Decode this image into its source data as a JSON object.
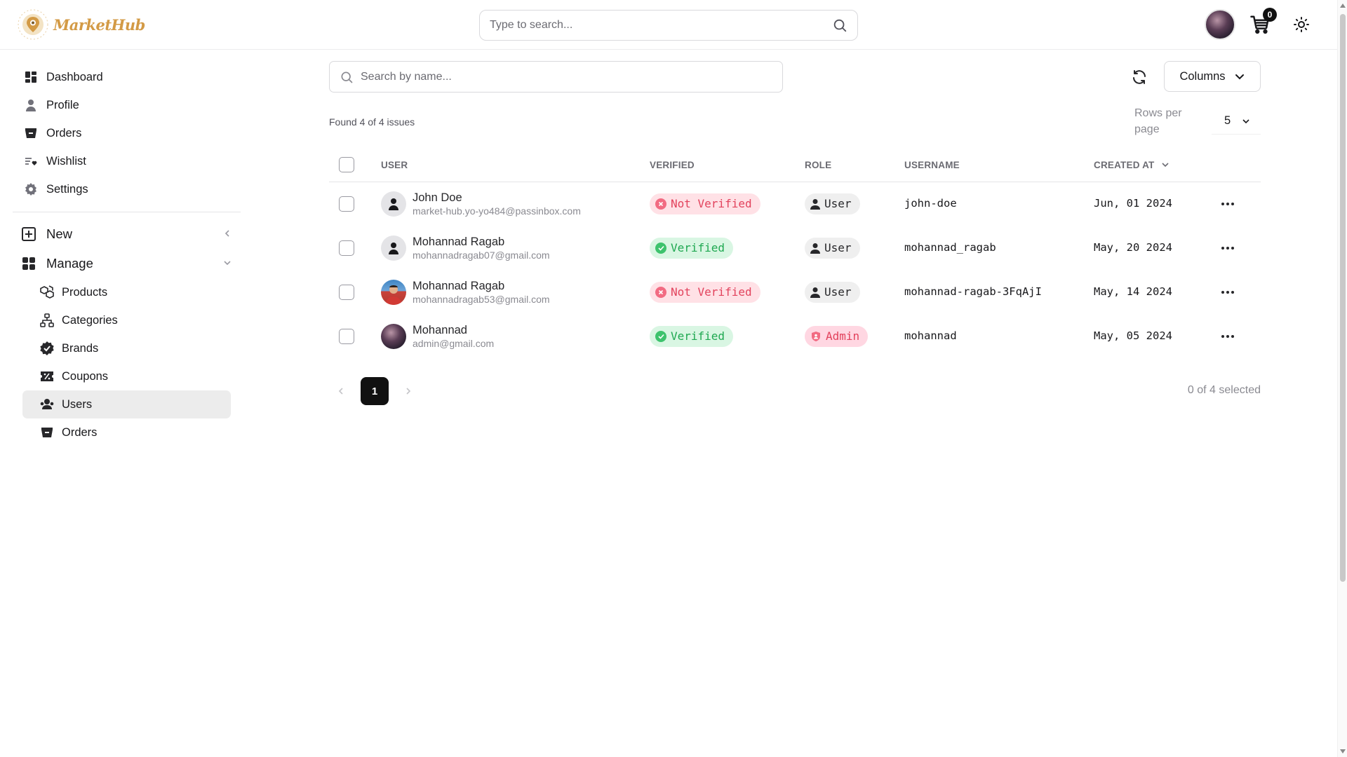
{
  "brand": {
    "name": "MarketHub"
  },
  "header": {
    "search_placeholder": "Type to search...",
    "cart_count": "0"
  },
  "sidebar": {
    "items": [
      {
        "label": "Dashboard",
        "icon": "dashboard-icon"
      },
      {
        "label": "Profile",
        "icon": "user-icon"
      },
      {
        "label": "Orders",
        "icon": "basket-icon"
      },
      {
        "label": "Wishlist",
        "icon": "wishlist-icon"
      },
      {
        "label": "Settings",
        "icon": "gear-icon"
      }
    ],
    "groups": [
      {
        "label": "New",
        "icon": "plus-square-icon",
        "expanded": false
      },
      {
        "label": "Manage",
        "icon": "grid-icon",
        "expanded": true,
        "children": [
          {
            "label": "Products",
            "icon": "boxes-icon"
          },
          {
            "label": "Categories",
            "icon": "hierarchy-icon"
          },
          {
            "label": "Brands",
            "icon": "badge-check-icon"
          },
          {
            "label": "Coupons",
            "icon": "coupon-icon"
          },
          {
            "label": "Users",
            "icon": "users-icon",
            "active": true
          },
          {
            "label": "Orders",
            "icon": "basket-icon"
          }
        ]
      }
    ]
  },
  "toolbar": {
    "search_placeholder": "Search by name...",
    "columns_label": "Columns",
    "found_text": "Found 4 of 4 issues",
    "rows_per_page_label": "Rows per page",
    "rows_per_page_value": "5"
  },
  "table": {
    "headers": [
      "USER",
      "VERIFIED",
      "ROLE",
      "USERNAME",
      "CREATED AT"
    ],
    "rows": [
      {
        "name": "John Doe",
        "email": "market-hub.yo-yo484@passinbox.com",
        "avatar": "placeholder",
        "verified": "Not Verified",
        "verified_ok": false,
        "role": "User",
        "username": "john-doe",
        "created": "Jun, 01 2024"
      },
      {
        "name": "Mohannad Ragab",
        "email": "mohannadragab07@gmail.com",
        "avatar": "placeholder",
        "verified": "Verified",
        "verified_ok": true,
        "role": "User",
        "username": "mohannad_ragab",
        "created": "May, 20 2024"
      },
      {
        "name": "Mohannad Ragab",
        "email": "mohannadragab53@gmail.com",
        "avatar": "photo-red",
        "verified": "Not Verified",
        "verified_ok": false,
        "role": "User",
        "username": "mohannad-ragab-3FqAjI",
        "created": "May, 14 2024"
      },
      {
        "name": "Mohannad",
        "email": "admin@gmail.com",
        "avatar": "photo-dark",
        "verified": "Verified",
        "verified_ok": true,
        "role": "Admin",
        "username": "mohannad",
        "created": "May, 05 2024"
      }
    ]
  },
  "pagination": {
    "current_page": "1",
    "selected_text": "0 of 4 selected"
  },
  "colors": {
    "brand": "#d39a45",
    "danger": "#e2425c",
    "success": "#1fa851",
    "active_bg": "#ececec"
  }
}
